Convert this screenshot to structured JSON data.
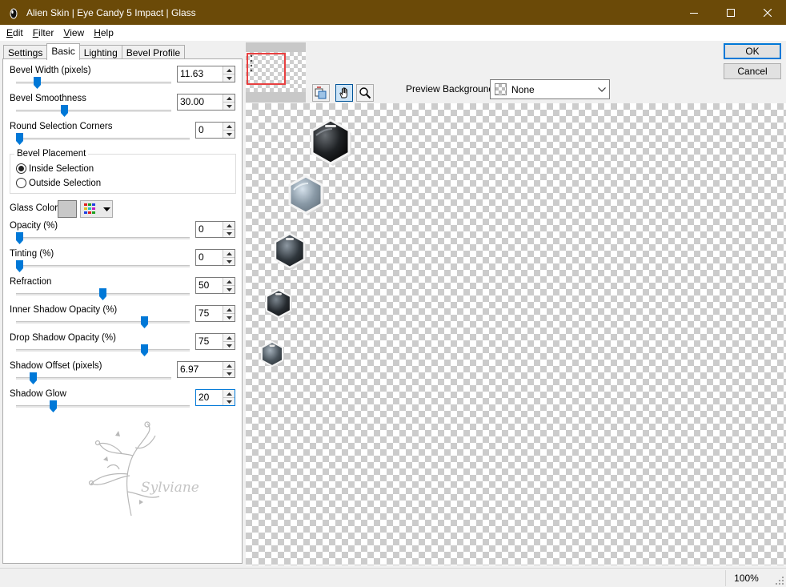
{
  "window": {
    "title": "Alien Skin | Eye Candy 5 Impact | Glass",
    "titlebar_color": "#6b4a08"
  },
  "menu": [
    {
      "label": "Edit",
      "mnemonic": "E",
      "rest": "dit"
    },
    {
      "label": "Filter",
      "mnemonic": "F",
      "rest": "ilter"
    },
    {
      "label": "View",
      "mnemonic": "V",
      "rest": "iew"
    },
    {
      "label": "Help",
      "mnemonic": "H",
      "rest": "elp"
    }
  ],
  "tabs": {
    "settings": "Settings",
    "basic": "Basic",
    "lighting": "Lighting",
    "bevel_profile": "Bevel Profile"
  },
  "controls": {
    "bevel_width": {
      "label": "Bevel Width (pixels)",
      "value": "11.63",
      "slider": 0.12
    },
    "bevel_smoothness": {
      "label": "Bevel Smoothness",
      "value": "30.00",
      "slider": 0.3
    },
    "round_corners": {
      "label": "Round Selection Corners",
      "value": "0",
      "slider": 0.0
    },
    "opacity": {
      "label": "Opacity (%)",
      "value": "0",
      "slider": 0.0
    },
    "tinting": {
      "label": "Tinting (%)",
      "value": "0",
      "slider": 0.0
    },
    "refraction": {
      "label": "Refraction",
      "value": "50",
      "slider": 0.5
    },
    "inner_shadow": {
      "label": "Inner Shadow Opacity (%)",
      "value": "75",
      "slider": 0.75
    },
    "drop_shadow": {
      "label": "Drop Shadow Opacity (%)",
      "value": "75",
      "slider": 0.75
    },
    "shadow_offset": {
      "label": "Shadow Offset (pixels)",
      "value": "6.97",
      "slider": 0.09
    },
    "shadow_glow": {
      "label": "Shadow Glow",
      "value": "20",
      "slider": 0.2
    }
  },
  "bevel_placement": {
    "legend": "Bevel Placement",
    "inside": "Inside Selection",
    "outside": "Outside Selection",
    "selected": "inside"
  },
  "glass_color": {
    "label": "Glass Color",
    "swatch": "#c8c8c8"
  },
  "preview_background": {
    "label": "Preview Background:",
    "value": "None"
  },
  "buttons": {
    "ok": "OK",
    "cancel": "Cancel"
  },
  "status": {
    "zoom": "100%"
  },
  "accent_color": "#0078d7"
}
